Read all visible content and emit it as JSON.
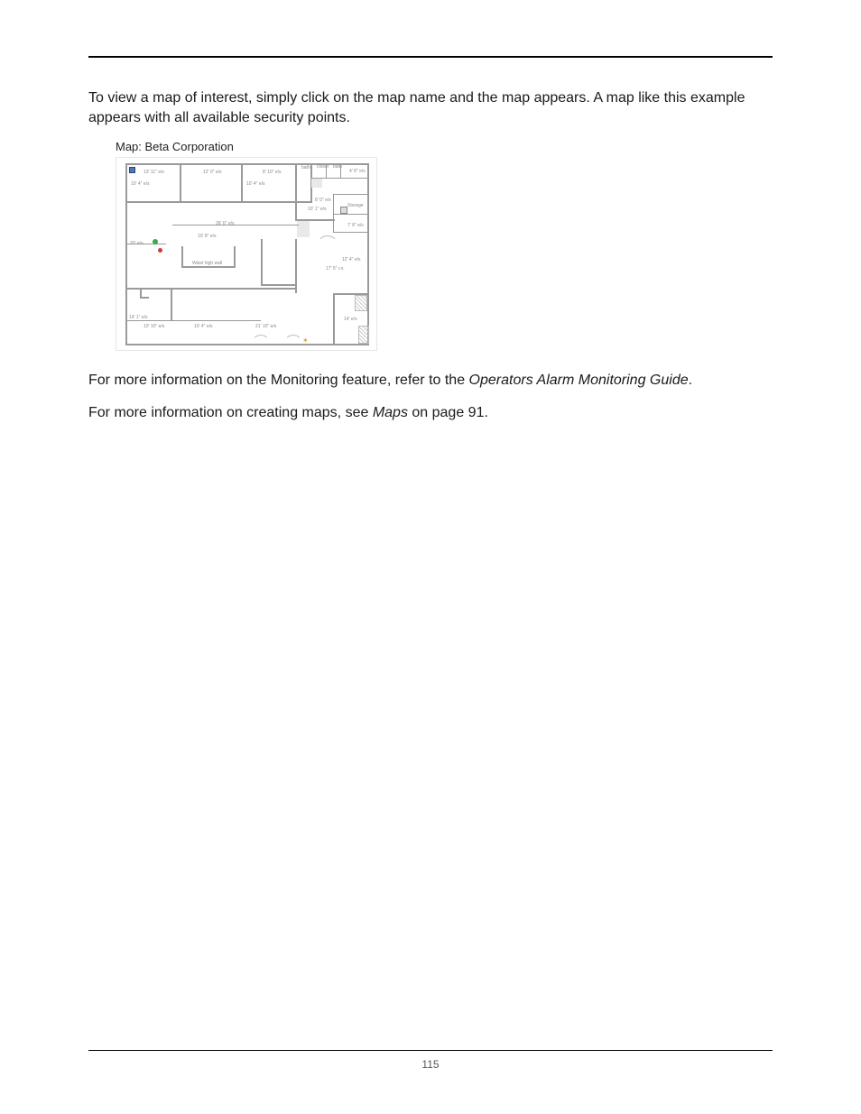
{
  "page_number": "115",
  "intro_paragraph": "To view a map of interest, simply click on the map name and the map appears. A map like this example appears with all available security points.",
  "map": {
    "title_prefix": "Map: ",
    "title_name": "Beta Corporation",
    "rooms": {
      "r1": "10' 4\" e/s",
      "dim_top1": "13' 11\" e/s",
      "dim_top2": "12' 0\" e/s",
      "dim_top3": "8' 10\" e/s",
      "r2": "10' 4\" e/s",
      "bath": "bath",
      "closet": "closet",
      "tr_dim": "4' 8\" e/s",
      "storage": "Storage",
      "mid_dim1": "8' 0\" e/s",
      "mid_dim2": "10' 1\" e/s",
      "big_dim": "26' 6\" e/s",
      "big_sub": "10' 8\" e/s",
      "left_mid": "20' e/s",
      "waist": "Waist high wall",
      "r_side1": "7' 8\" e/s",
      "r_side2": "12' 4\" e/s",
      "r_side3": "17' 5\" r.o.",
      "bl1": "14' 1\" e/s",
      "bl2": "10' 10\" e/s",
      "bm": "10' 4\" e/s",
      "br_room": "14' e/s",
      "br1": "21' 10\" e/s"
    }
  },
  "para2_prefix": "For more information on the Monitoring feature, refer to the ",
  "para2_italic": "Operators Alarm Monitoring Guide",
  "para2_suffix": ".",
  "para3_prefix": "For more information on creating maps, see ",
  "para3_italic": "Maps",
  "para3_suffix": " on page 91."
}
